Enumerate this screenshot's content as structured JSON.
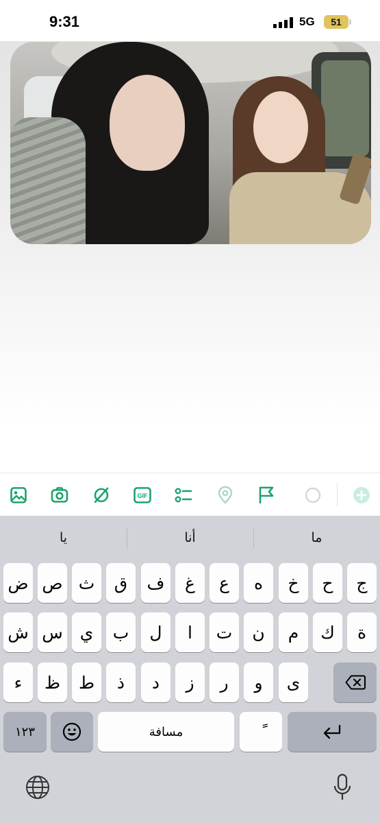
{
  "status_bar": {
    "time": "9:31",
    "network": "5G",
    "battery": "51",
    "icons": [
      "cellular-signal-icon",
      "battery-icon"
    ]
  },
  "media": {
    "type": "video-attachment",
    "description_icon": "video-thumbnail"
  },
  "toolbar": {
    "accent_color": "#1aa36c",
    "disabled_color": "#a9d9c2",
    "items": [
      {
        "icon": "image-icon"
      },
      {
        "icon": "camera-icon"
      },
      {
        "icon": "sticker-icon"
      },
      {
        "icon": "gif-icon",
        "label": "GIF"
      },
      {
        "icon": "poll-icon"
      },
      {
        "icon": "location-icon"
      },
      {
        "icon": "flag-icon"
      },
      {
        "icon": "progress-circle-icon"
      },
      {
        "icon": "add-icon"
      }
    ]
  },
  "keyboard": {
    "suggestions": [
      "يا",
      "أنا",
      "ما"
    ],
    "row1": [
      "ض",
      "ص",
      "ث",
      "ق",
      "ف",
      "غ",
      "ع",
      "ه",
      "خ",
      "ح",
      "ج"
    ],
    "row2": [
      "ش",
      "س",
      "ي",
      "ب",
      "ل",
      "ا",
      "ت",
      "ن",
      "م",
      "ك",
      "ة"
    ],
    "row3": [
      "ء",
      "ظ",
      "ط",
      "ذ",
      "د",
      "ز",
      "ر",
      "و",
      "ى"
    ],
    "numbers_key": "١٢٣",
    "space_key": "مسافة",
    "tanween_key": "ً",
    "icons": [
      "delete-icon",
      "emoji-icon",
      "return-icon",
      "globe-icon",
      "microphone-icon"
    ]
  }
}
